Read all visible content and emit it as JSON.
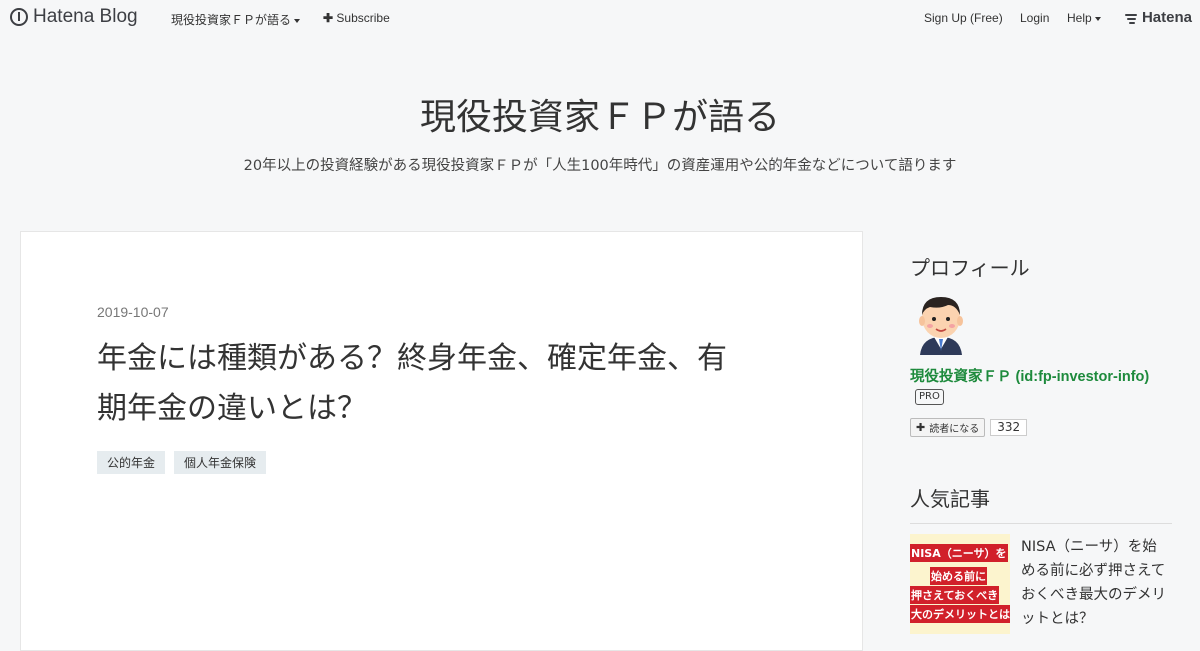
{
  "topbar": {
    "logo": "Hatena Blog",
    "blog_menu": "現役投資家ＦＰが語る",
    "subscribe": "Subscribe",
    "signup": "Sign Up (Free)",
    "login": "Login",
    "help": "Help",
    "hatena": "Hatena"
  },
  "header": {
    "title": "現役投資家ＦＰが語る",
    "description": "20年以上の投資経験がある現役投資家ＦＰが「人生100年時代」の資産運用や公的年金などについて語ります"
  },
  "entry": {
    "date": "2019-10-07",
    "title_line1": "年金には種類がある？終身年金、確定年金、有",
    "title_line2": "期年金の違いとは？",
    "categories": [
      "公的年金",
      "個人年金保険"
    ]
  },
  "sidebar": {
    "profile_heading": "プロフィール",
    "profile_name": "現役投資家ＦＰ (id:fp-investor-info)",
    "pro_badge": "PRO",
    "subscribe_label": "読者になる",
    "subscriber_count": "332",
    "popular_heading": "人気記事",
    "popular": [
      {
        "title": "NISA（ニーサ）を始める前に必ず押さえておくべき最大のデメリットとは？",
        "thumb_lines": [
          "NISA（ニーサ）を",
          "始める前に",
          "押さえておくべき",
          "大のデメリットとは"
        ]
      }
    ]
  },
  "colors": {
    "background": "#f6f7f8",
    "profile_link": "#1d8a3c",
    "category_bg": "#e6ecef"
  }
}
